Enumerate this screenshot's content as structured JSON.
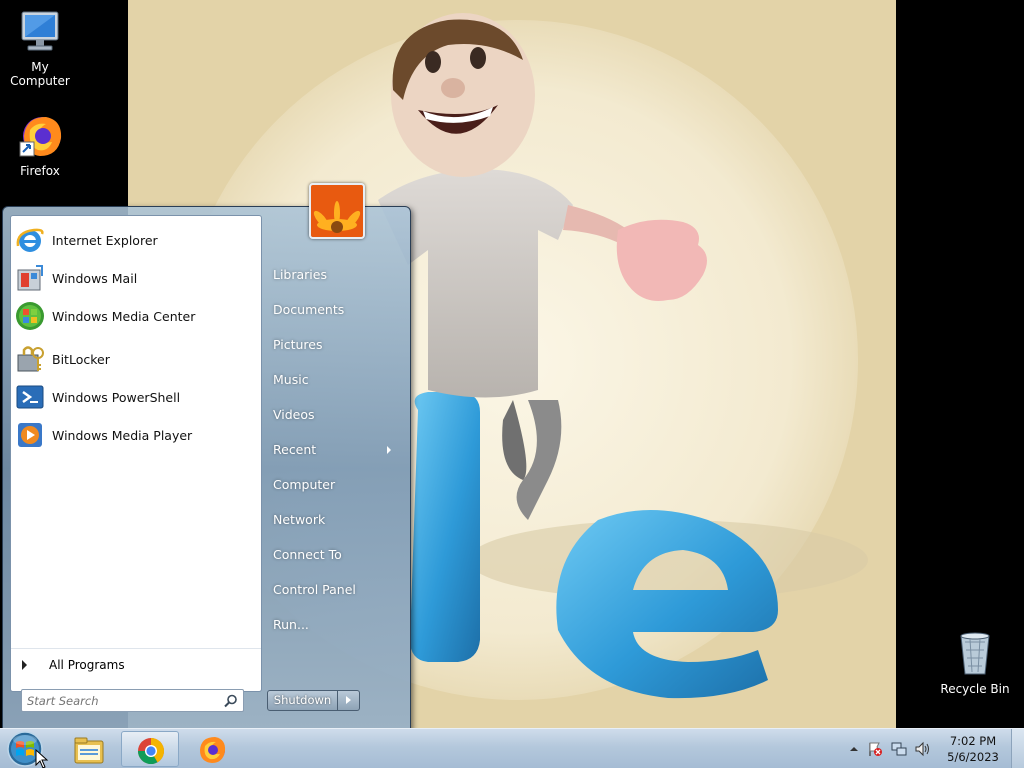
{
  "desktop": {
    "icons": [
      {
        "label": "My Computer",
        "icon": "computer-icon"
      },
      {
        "label": "Firefox",
        "icon": "firefox-icon"
      },
      {
        "label": "Recycle Bin",
        "icon": "recycle-bin-icon"
      }
    ]
  },
  "start_menu": {
    "programs": [
      {
        "label": "Internet Explorer",
        "icon": "internet-explorer-icon"
      },
      {
        "label": "Windows Mail",
        "icon": "windows-mail-icon"
      },
      {
        "label": "Windows Media Center",
        "icon": "windows-media-center-icon"
      },
      {
        "label": "BitLocker",
        "icon": "bitlocker-icon"
      },
      {
        "label": "Windows PowerShell",
        "icon": "powershell-icon"
      },
      {
        "label": "Windows Media Player",
        "icon": "media-player-icon"
      }
    ],
    "all_programs_label": "All Programs",
    "search_placeholder": "Start Search",
    "places": [
      {
        "label": "Libraries"
      },
      {
        "label": "Documents"
      },
      {
        "label": "Pictures"
      },
      {
        "label": "Music"
      },
      {
        "label": "Videos"
      },
      {
        "label": "Recent",
        "has_submenu": true
      },
      {
        "label": "Computer"
      },
      {
        "label": "Network"
      },
      {
        "label": "Connect To"
      },
      {
        "label": "Control Panel"
      },
      {
        "label": "Run..."
      }
    ],
    "shutdown_label": "Shutdown"
  },
  "taskbar": {
    "pinned": [
      {
        "icon": "file-explorer-icon"
      },
      {
        "icon": "chrome-icon",
        "active": true
      },
      {
        "icon": "firefox-icon"
      }
    ],
    "tray_icons": [
      "show-hidden-icons-chevron",
      "action-center-flag-icon",
      "network-icon",
      "volume-icon"
    ],
    "clock": {
      "time": "7:02 PM",
      "date": "5/6/2023"
    }
  },
  "colors": {
    "taskbar": "#b4c8dc",
    "wallpaper_bg": "#e3d3a8",
    "ie_blue": "#2e9ad8"
  }
}
